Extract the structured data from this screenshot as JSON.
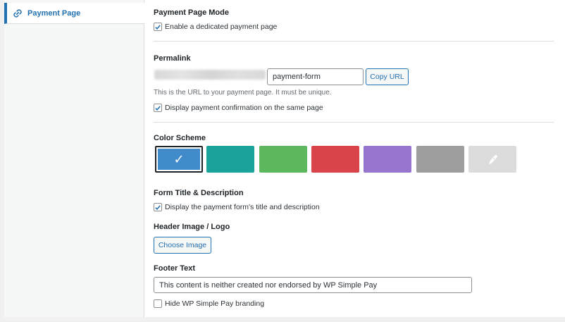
{
  "sidebar": {
    "items": [
      {
        "label": "Payment Page",
        "icon": "link-icon"
      }
    ]
  },
  "mode": {
    "heading": "Payment Page Mode",
    "enable_label": "Enable a dedicated payment page",
    "enabled": true
  },
  "permalink": {
    "heading": "Permalink",
    "slug_value": "payment-form",
    "copy_label": "Copy URL",
    "description": "This is the URL to your payment page. It must be unique.",
    "confirmation_label": "Display payment confirmation on the same page",
    "confirmation_checked": true
  },
  "color_scheme": {
    "heading": "Color Scheme",
    "selected": 0,
    "swatches": [
      {
        "name": "blue",
        "color": "#428bca"
      },
      {
        "name": "teal",
        "color": "#1aa39a"
      },
      {
        "name": "green",
        "color": "#5cb85c"
      },
      {
        "name": "red",
        "color": "#d9444a"
      },
      {
        "name": "purple",
        "color": "#9575cd"
      },
      {
        "name": "gray",
        "color": "#9e9e9e"
      },
      {
        "name": "custom",
        "color": "#dcdcdc",
        "icon": "eyedropper-icon"
      }
    ]
  },
  "form_title": {
    "heading": "Form Title & Description",
    "display_label": "Display the payment form's title and description",
    "checked": true
  },
  "header_image": {
    "heading": "Header Image / Logo",
    "button_label": "Choose Image"
  },
  "footer": {
    "heading": "Footer Text",
    "text_value": "This content is neither created nor endorsed by WP Simple Pay",
    "hide_branding_label": "Hide WP Simple Pay branding",
    "hide_branding_checked": false
  }
}
